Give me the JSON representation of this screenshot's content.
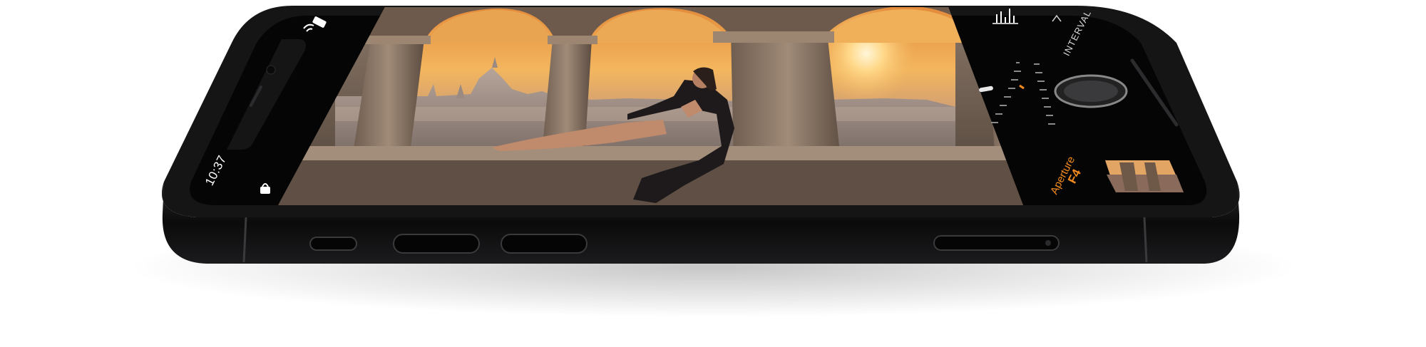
{
  "status_bar": {
    "time": "10:37"
  },
  "camera": {
    "mode_label": "INTERVAL",
    "setting_label": "Aperture",
    "setting_value": "F4"
  },
  "icons": {
    "wifi": "wifi-icon",
    "battery": "battery-icon",
    "lock": "orientation-lock-icon",
    "histogram": "histogram-icon",
    "chevron": "chevron-up-icon"
  },
  "colors": {
    "accent": "#f28a1e",
    "phone_body": "#0e0e0f",
    "screen": "#050505"
  }
}
